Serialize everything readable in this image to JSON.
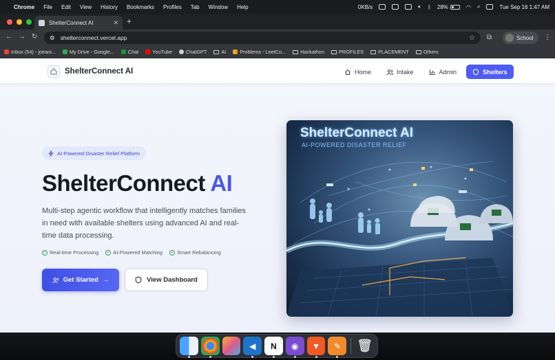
{
  "menubar": {
    "app": "Chrome",
    "items": [
      "File",
      "Edit",
      "View",
      "History",
      "Bookmarks",
      "Profiles",
      "Tab",
      "Window",
      "Help"
    ],
    "network": "0KB/s",
    "battery": "28%",
    "datetime": "Tue Sep 16  1:47 AM"
  },
  "browser": {
    "tab_title": "ShelterConnect AI",
    "url": "shelterconnect.vercel.app",
    "profile": "School",
    "bookmarks": [
      "Inbox (54) - joeani...",
      "My Drive - Google...",
      "Chat",
      "YouTube",
      "ChatGPT",
      "AI",
      "Problems - LeetCo...",
      "Hackathon",
      "PROFILES",
      "PLACEMENT",
      "Others"
    ]
  },
  "nav": {
    "brand": "ShelterConnect AI",
    "links": [
      {
        "label": "Home",
        "icon": "home-icon"
      },
      {
        "label": "Intake",
        "icon": "users-icon"
      },
      {
        "label": "Admin",
        "icon": "bar-chart-icon"
      },
      {
        "label": "Shelters",
        "icon": "shield-icon"
      }
    ],
    "active": "Shelters"
  },
  "hero": {
    "badge": "AI-Powered Disaster Relief Platform",
    "title_main": "ShelterConnect",
    "title_accent": "AI",
    "description": "Multi-step agentic workflow that intelligently matches families in need with available shelters using advanced AI and real-time data processing.",
    "features": [
      "Real-time Processing",
      "AI-Powered Matching",
      "Smart Rebalancing"
    ],
    "primary_button": "Get Started",
    "secondary_button": "View Dashboard",
    "image_title": "ShelterConnect AI",
    "image_subtitle": "AI-POWERED DISASTER RELIEF"
  },
  "colors": {
    "accent": "#4f5cf0",
    "check": "#2fa15a",
    "badge_bg": "#e3e8fb"
  },
  "dock": [
    "Finder",
    "Chrome",
    "Launchpad",
    "VS Code",
    "Notion",
    "GitHub Desktop",
    "Brave",
    "Editor",
    "Trash"
  ]
}
